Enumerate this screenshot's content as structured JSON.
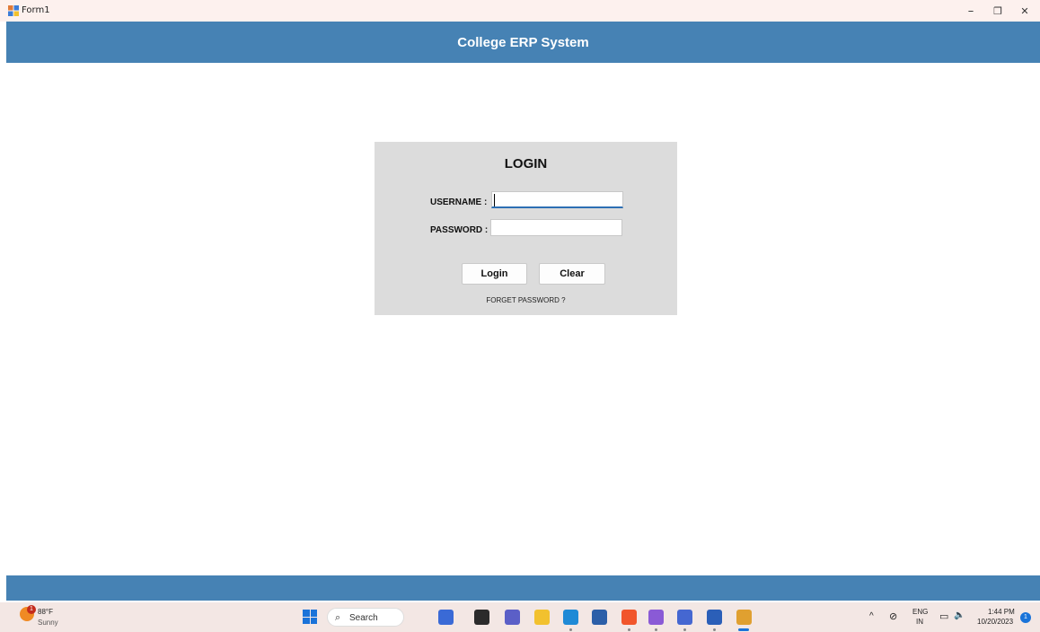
{
  "window": {
    "title": "Form1",
    "minimize": "–",
    "restore": "❐",
    "close": "✕"
  },
  "header": {
    "title": "College ERP System"
  },
  "login": {
    "title": "LOGIN",
    "username_label": "USERNAME :",
    "username_value": "",
    "password_label": "PASSWORD :",
    "password_value": "",
    "login_button": "Login",
    "clear_button": "Clear",
    "forget_link": "FORGET PASSWORD ?"
  },
  "taskbar": {
    "weather_temp": "88°F",
    "weather_condition": "Sunny",
    "weather_badge": "1",
    "search_label": "Search",
    "apps": [
      {
        "name": "copilot-app-icon",
        "color": "#3a6ad6"
      },
      {
        "name": "file-explorer-dark-icon",
        "color": "#2b2b2b"
      },
      {
        "name": "teams-chat-icon",
        "color": "#5b5fc7"
      },
      {
        "name": "file-explorer-icon",
        "color": "#f2c12e"
      },
      {
        "name": "edge-icon",
        "color": "#1f8ad6"
      },
      {
        "name": "store-icon",
        "color": "#2c5fa8"
      },
      {
        "name": "brave-icon",
        "color": "#f1552b"
      },
      {
        "name": "visual-studio-icon",
        "color": "#8a5ad6"
      },
      {
        "name": "infinity-app-icon",
        "color": "#4567d1"
      },
      {
        "name": "word-icon",
        "color": "#2b5fb8"
      },
      {
        "name": "form-app-icon",
        "color": "#e0a030"
      }
    ],
    "tray_chevron": "^",
    "lang_top": "ENG",
    "lang_bottom": "IN",
    "time": "1:44 PM",
    "date": "10/20/2023",
    "notifications": "1"
  },
  "colors": {
    "header_bg": "#4682b4",
    "panel_bg": "#dcdcdc",
    "taskbar_bg": "#f3e7e4"
  }
}
